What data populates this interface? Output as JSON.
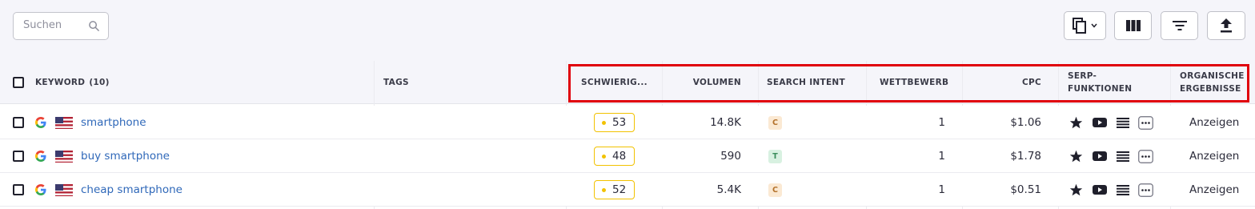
{
  "search": {
    "placeholder": "Suchen",
    "icon": "search-icon"
  },
  "toolbar": {
    "buttons": [
      {
        "name": "copy-dropdown-button",
        "icon": "copy-icon"
      },
      {
        "name": "columns-button",
        "icon": "columns-icon"
      },
      {
        "name": "filter-button",
        "icon": "filter-icon"
      },
      {
        "name": "export-button",
        "icon": "upload-icon"
      }
    ]
  },
  "table": {
    "headers": {
      "keyword": "KEYWORD",
      "keyword_count": "(10)",
      "tags": "TAGS",
      "difficulty": "SCHWIERIG...",
      "volume": "VOLUMEN",
      "intent": "SEARCH INTENT",
      "competition": "WETTBEWERB",
      "cpc": "CPC",
      "serp_line1": "SERP-",
      "serp_line2": "FUNKTIONEN",
      "organic_line1": "ORGANISCHE",
      "organic_line2": "ERGEBNISSE"
    },
    "rows": [
      {
        "keyword": "smartphone",
        "difficulty": "53",
        "volume": "14.8K",
        "intent": "C",
        "competition": "1",
        "cpc": "$1.06",
        "organic": "Anzeigen"
      },
      {
        "keyword": "buy smartphone",
        "difficulty": "48",
        "volume": "590",
        "intent": "T",
        "competition": "1",
        "cpc": "$1.78",
        "organic": "Anzeigen"
      },
      {
        "keyword": "cheap smartphone",
        "difficulty": "52",
        "volume": "5.4K",
        "intent": "C",
        "competition": "1",
        "cpc": "$0.51",
        "organic": "Anzeigen"
      }
    ]
  },
  "colors": {
    "keyword_link": "#2f68b9",
    "difficulty_border": "#f2c200",
    "intent_C_bg": "#fbe9d3",
    "intent_C_fg": "#b3712a",
    "intent_T_bg": "#d8f1e1",
    "intent_T_fg": "#3a8d5b",
    "highlight": "#e0000b"
  }
}
